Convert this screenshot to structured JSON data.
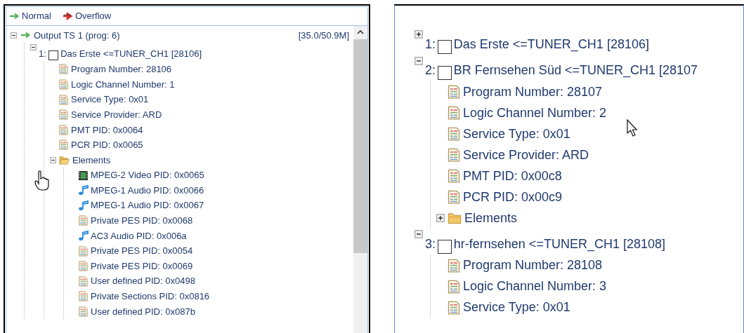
{
  "left_panel": {
    "legend": [
      {
        "kind": "normal",
        "label": "Normal",
        "color": "#4caf50"
      },
      {
        "kind": "overflow",
        "label": "Overflow",
        "color": "#d32f2f"
      }
    ],
    "tree": [
      {
        "kind": "output",
        "label": "Output TS 1 (prog: 6)",
        "color": "#4caf50",
        "rate": "[35.0/50.9M]",
        "expanded": true,
        "children": [
          {
            "kind": "program",
            "number": "1:",
            "checked": false,
            "label": "Das Erste <=TUNER_CH1 [28106]",
            "expanded": true,
            "children": [
              {
                "kind": "info",
                "label": "Program Number: 28106"
              },
              {
                "kind": "info",
                "label": "Logic Channel Number: 1"
              },
              {
                "kind": "info",
                "label": "Service Type: 0x01"
              },
              {
                "kind": "info",
                "label": "Service Provider: ARD"
              },
              {
                "kind": "info",
                "label": "PMT PID: 0x0064"
              },
              {
                "kind": "info",
                "label": "PCR PID: 0x0065"
              },
              {
                "kind": "folder",
                "label": "Elements",
                "expanded": true,
                "children": [
                  {
                    "kind": "video",
                    "label": "MPEG-2 Video PID: 0x0065"
                  },
                  {
                    "kind": "audio",
                    "label": "MPEG-1 Audio PID: 0x0066"
                  },
                  {
                    "kind": "audio",
                    "label": "MPEG-1 Audio PID: 0x0067"
                  },
                  {
                    "kind": "info",
                    "label": "Private PES PID: 0x0068"
                  },
                  {
                    "kind": "audio",
                    "label": "AC3 Audio PID: 0x006a"
                  },
                  {
                    "kind": "info",
                    "label": "Private PES PID: 0x0054"
                  },
                  {
                    "kind": "info",
                    "label": "Private PES PID: 0x0069"
                  },
                  {
                    "kind": "info",
                    "label": "User defined PID: 0x0498"
                  },
                  {
                    "kind": "info",
                    "label": "Private Sections PID: 0x0816"
                  },
                  {
                    "kind": "info",
                    "label": "User defined PID: 0x087b"
                  }
                ]
              }
            ]
          }
        ]
      }
    ]
  },
  "right_panel": {
    "tree": [
      {
        "kind": "program",
        "number": "1:",
        "checked": false,
        "label": "Das Erste <=TUNER_CH1 [28106]",
        "expanded": false
      },
      {
        "kind": "program",
        "number": "2:",
        "checked": false,
        "label": "BR Fernsehen Süd <=TUNER_CH1 [28107",
        "expanded": true,
        "children": [
          {
            "kind": "info",
            "label": "Program Number: 28107"
          },
          {
            "kind": "info",
            "label": "Logic Channel Number: 2"
          },
          {
            "kind": "info",
            "label": "Service Type: 0x01"
          },
          {
            "kind": "info",
            "label": "Service Provider: ARD"
          },
          {
            "kind": "info",
            "label": "PMT PID: 0x00c8"
          },
          {
            "kind": "info",
            "label": "PCR PID: 0x00c9"
          },
          {
            "kind": "folder",
            "label": "Elements",
            "expanded": false
          }
        ]
      },
      {
        "kind": "program",
        "number": "3:",
        "checked": false,
        "label": "hr-fernsehen <=TUNER_CH1 [28108]",
        "expanded": true,
        "children": [
          {
            "kind": "info",
            "label": "Program Number: 28108"
          },
          {
            "kind": "info",
            "label": "Logic Channel Number: 3"
          },
          {
            "kind": "info",
            "label": "Service Type: 0x01"
          }
        ]
      }
    ]
  }
}
